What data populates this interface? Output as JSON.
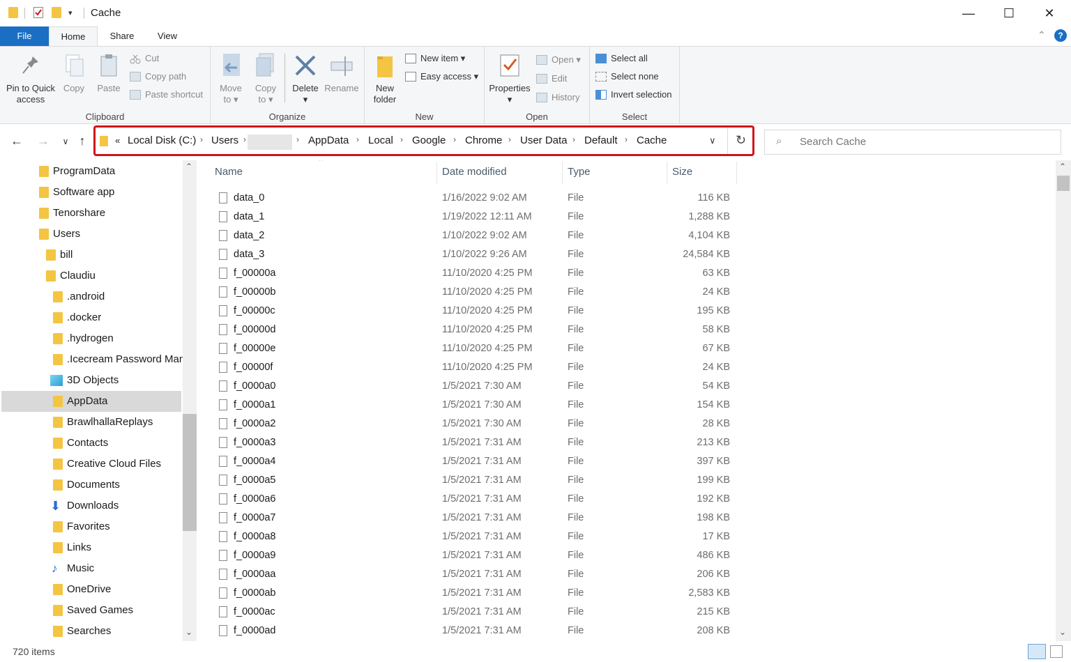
{
  "window": {
    "title": "Cache",
    "controls": {
      "minimize": "—",
      "maximize": "☐",
      "close": "✕"
    }
  },
  "tabs": [
    {
      "label": "File"
    },
    {
      "label": "Home"
    },
    {
      "label": "Share"
    },
    {
      "label": "View"
    }
  ],
  "ribbon": {
    "clipboard": {
      "label": "Clipboard",
      "pin": "Pin to Quick access",
      "pin_line1": "Pin to Quick",
      "pin_line2": "access",
      "copy": "Copy",
      "paste": "Paste",
      "cut": "Cut",
      "copy_path": "Copy path",
      "paste_shortcut": "Paste shortcut"
    },
    "organize": {
      "label": "Organize",
      "move_to_1": "Move",
      "move_to_2": "to",
      "copy_to_1": "Copy",
      "copy_to_2": "to",
      "delete": "Delete",
      "rename": "Rename"
    },
    "new": {
      "label": "New",
      "new_folder_1": "New",
      "new_folder_2": "folder",
      "new_item": "New item",
      "easy_access": "Easy access"
    },
    "open": {
      "label": "Open",
      "properties": "Properties",
      "open": "Open",
      "edit": "Edit",
      "history": "History"
    },
    "select": {
      "label": "Select",
      "select_all": "Select all",
      "select_none": "Select none",
      "invert_selection": "Invert selection"
    }
  },
  "address": {
    "overflow": "«",
    "crumbs": [
      "Local Disk (C:)",
      "Users",
      "",
      "AppData",
      "Local",
      "Google",
      "Chrome",
      "User Data",
      "Default",
      "Cache"
    ]
  },
  "search": {
    "placeholder": "Search Cache"
  },
  "navpane": {
    "items": [
      {
        "label": "ProgramData",
        "icon": "folder"
      },
      {
        "label": "Software app",
        "icon": "folder"
      },
      {
        "label": "Tenorshare",
        "icon": "folder"
      },
      {
        "label": "Users",
        "icon": "folder"
      },
      {
        "label": "bill",
        "icon": "folder"
      },
      {
        "label": "Claudiu",
        "icon": "folder"
      },
      {
        "label": ".android",
        "icon": "folder"
      },
      {
        "label": ".docker",
        "icon": "folder"
      },
      {
        "label": ".hydrogen",
        "icon": "folder"
      },
      {
        "label": ".Icecream Password Mana",
        "icon": "folder"
      },
      {
        "label": "3D Objects",
        "icon": "3d-objects"
      },
      {
        "label": "AppData",
        "icon": "folder"
      },
      {
        "label": "BrawlhallaReplays",
        "icon": "folder"
      },
      {
        "label": "Contacts",
        "icon": "contacts"
      },
      {
        "label": "Creative Cloud Files",
        "icon": "folder"
      },
      {
        "label": "Documents",
        "icon": "folder"
      },
      {
        "label": "Downloads",
        "icon": "download-arrow"
      },
      {
        "label": "Favorites",
        "icon": "folder"
      },
      {
        "label": "Links",
        "icon": "folder"
      },
      {
        "label": "Music",
        "icon": "music-note"
      },
      {
        "label": "OneDrive",
        "icon": "folder"
      },
      {
        "label": "Saved Games",
        "icon": "saved-games"
      },
      {
        "label": "Searches",
        "icon": "search-folder"
      }
    ]
  },
  "columns": {
    "name": "Name",
    "date": "Date modified",
    "type": "Type",
    "size": "Size"
  },
  "files": [
    {
      "name": "data_0",
      "date": "1/16/2022 9:02 AM",
      "type": "File",
      "size": "116 KB"
    },
    {
      "name": "data_1",
      "date": "1/19/2022 12:11 AM",
      "type": "File",
      "size": "1,288 KB"
    },
    {
      "name": "data_2",
      "date": "1/10/2022 9:02 AM",
      "type": "File",
      "size": "4,104 KB"
    },
    {
      "name": "data_3",
      "date": "1/10/2022 9:26 AM",
      "type": "File",
      "size": "24,584 KB"
    },
    {
      "name": "f_00000a",
      "date": "11/10/2020 4:25 PM",
      "type": "File",
      "size": "63 KB"
    },
    {
      "name": "f_00000b",
      "date": "11/10/2020 4:25 PM",
      "type": "File",
      "size": "24 KB"
    },
    {
      "name": "f_00000c",
      "date": "11/10/2020 4:25 PM",
      "type": "File",
      "size": "195 KB"
    },
    {
      "name": "f_00000d",
      "date": "11/10/2020 4:25 PM",
      "type": "File",
      "size": "58 KB"
    },
    {
      "name": "f_00000e",
      "date": "11/10/2020 4:25 PM",
      "type": "File",
      "size": "67 KB"
    },
    {
      "name": "f_00000f",
      "date": "11/10/2020 4:25 PM",
      "type": "File",
      "size": "24 KB"
    },
    {
      "name": "f_0000a0",
      "date": "1/5/2021 7:30 AM",
      "type": "File",
      "size": "54 KB"
    },
    {
      "name": "f_0000a1",
      "date": "1/5/2021 7:30 AM",
      "type": "File",
      "size": "154 KB"
    },
    {
      "name": "f_0000a2",
      "date": "1/5/2021 7:30 AM",
      "type": "File",
      "size": "28 KB"
    },
    {
      "name": "f_0000a3",
      "date": "1/5/2021 7:31 AM",
      "type": "File",
      "size": "213 KB"
    },
    {
      "name": "f_0000a4",
      "date": "1/5/2021 7:31 AM",
      "type": "File",
      "size": "397 KB"
    },
    {
      "name": "f_0000a5",
      "date": "1/5/2021 7:31 AM",
      "type": "File",
      "size": "199 KB"
    },
    {
      "name": "f_0000a6",
      "date": "1/5/2021 7:31 AM",
      "type": "File",
      "size": "192 KB"
    },
    {
      "name": "f_0000a7",
      "date": "1/5/2021 7:31 AM",
      "type": "File",
      "size": "198 KB"
    },
    {
      "name": "f_0000a8",
      "date": "1/5/2021 7:31 AM",
      "type": "File",
      "size": "17 KB"
    },
    {
      "name": "f_0000a9",
      "date": "1/5/2021 7:31 AM",
      "type": "File",
      "size": "486 KB"
    },
    {
      "name": "f_0000aa",
      "date": "1/5/2021 7:31 AM",
      "type": "File",
      "size": "206 KB"
    },
    {
      "name": "f_0000ab",
      "date": "1/5/2021 7:31 AM",
      "type": "File",
      "size": "2,583 KB"
    },
    {
      "name": "f_0000ac",
      "date": "1/5/2021 7:31 AM",
      "type": "File",
      "size": "215 KB"
    },
    {
      "name": "f_0000ad",
      "date": "1/5/2021 7:31 AM",
      "type": "File",
      "size": "208 KB"
    }
  ],
  "status": {
    "items_count": "720 items"
  },
  "colors": {
    "accent": "#1a6fc4",
    "highlight_box": "#d0121b",
    "folder": "#f4c542",
    "selected": "#d9d9d9"
  }
}
